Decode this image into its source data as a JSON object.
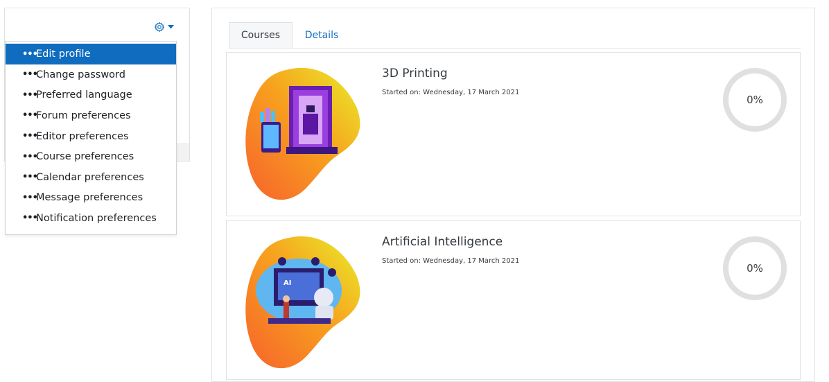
{
  "menu": {
    "items": [
      {
        "label": "Edit profile",
        "active": true
      },
      {
        "label": "Change password"
      },
      {
        "label": "Preferred language"
      },
      {
        "label": "Forum preferences"
      },
      {
        "label": "Editor preferences"
      },
      {
        "label": "Course preferences"
      },
      {
        "label": "Calendar preferences"
      },
      {
        "label": "Message preferences"
      },
      {
        "label": "Notification preferences"
      }
    ],
    "bullet": "•••"
  },
  "tabs": {
    "courses": "Courses",
    "details": "Details"
  },
  "courses": [
    {
      "title": "3D Printing",
      "started": "Started on: Wednesday, 17 March 2021",
      "progress": "0%",
      "progress_value": 0
    },
    {
      "title": "Artificial Intelligence",
      "started": "Started on: Wednesday, 17 March 2021",
      "progress": "0%",
      "progress_value": 0
    }
  ],
  "image_labels": {
    "ai": "AI"
  },
  "colors": {
    "accent": "#0f6cbf",
    "ring": "#e0e0e0",
    "blob_start": "#f7622c",
    "blob_end": "#e8e82a"
  }
}
